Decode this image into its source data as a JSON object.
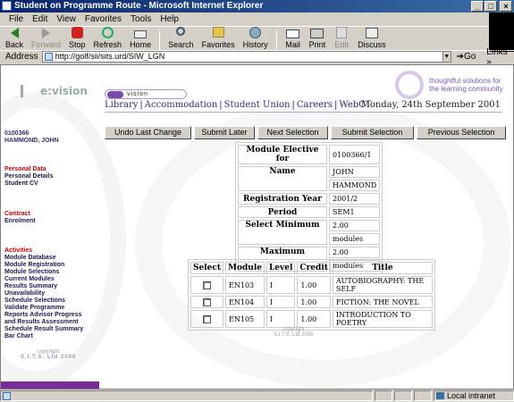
{
  "window": {
    "title": "Student on Programme Route - Microsoft Internet Explorer",
    "buttons": [
      "_",
      "□",
      "×"
    ]
  },
  "menu": [
    "File",
    "Edit",
    "View",
    "Favorites",
    "Tools",
    "Help"
  ],
  "toolbar": {
    "back": "Back",
    "forward": "Forward",
    "stop": "Stop",
    "refresh": "Refresh",
    "home": "Home",
    "search": "Search",
    "favorites": "Favorites",
    "history": "History",
    "mail": "Mail",
    "print": "Print",
    "edit": "Edit",
    "discuss": "Discuss"
  },
  "address": {
    "label": "Address",
    "url": "http://golf/sii/sits.urd/SIW_LGN",
    "go": "Go",
    "links": "Links"
  },
  "branding": {
    "evision": "e:vision",
    "pill": "vision",
    "tagline_1": "thoughtful solutions for",
    "tagline_2": "the learning community"
  },
  "topnav": {
    "items": [
      "Library",
      "Accommodation",
      "Student Union",
      "Careers",
      "WebCT"
    ],
    "date": "Monday, 24th September 2001"
  },
  "student": {
    "id": "0100366",
    "name": "HAMMOND, JOHN"
  },
  "sidebar": {
    "personal_head": "Personal Data",
    "personal_items": [
      "Personal Details",
      "Student CV"
    ],
    "contract_head": "Contract",
    "contract_items": [
      "Enrolment"
    ],
    "activities_head": "Activities",
    "activities_items": [
      "Module Database",
      "Module Registration",
      "Module Selections",
      "Current Modules",
      "Results Summary",
      "Unavailability",
      "Schedule Selections",
      "Validate Programme",
      "Reports Advisor Progress",
      "and Results Assessment",
      "Schedule Result Summary",
      "Bar Chart"
    ],
    "copyright_1": "copyright",
    "copyright_2": "S.I.T.S. Ltd 2000"
  },
  "actions": [
    "Undo Last Change",
    "Submit Later",
    "Next Selection",
    "Submit Selection",
    "Previous Selection"
  ],
  "info": {
    "module_elective_label": "Module Elective for",
    "module_elective_value": "0100366/1",
    "name_label": "Name",
    "name_value_1": "JOHN",
    "name_value_2": "HAMMOND",
    "reg_year_label": "Registration Year",
    "reg_year_value": "2001/2",
    "period_label": "Period",
    "period_value": "SEM1",
    "select_min_label": "Select Minimum",
    "select_min_value": "2.00",
    "select_min_unit": "modules",
    "maximum_label": "Maximum",
    "maximum_value": "2.00",
    "maximum_unit": "modules"
  },
  "modules": {
    "headers": [
      "Select",
      "Module",
      "Level",
      "Credit",
      "Title"
    ],
    "rows": [
      {
        "module": "EN103",
        "level": "I",
        "credit": "1.00",
        "title": "AUTOBIOGRAPHY: THE SELF"
      },
      {
        "module": "EN104",
        "level": "I",
        "credit": "1.00",
        "title": "FICTION: THE NOVEL"
      },
      {
        "module": "EN105",
        "level": "I",
        "credit": "1.00",
        "title": "INTRODUCTION TO POETRY"
      }
    ]
  },
  "mid_copyright_1": "copyright",
  "mid_copyright_2": "S.I.T.S. Ltd 2000",
  "status": {
    "zone": "Local intranet"
  }
}
